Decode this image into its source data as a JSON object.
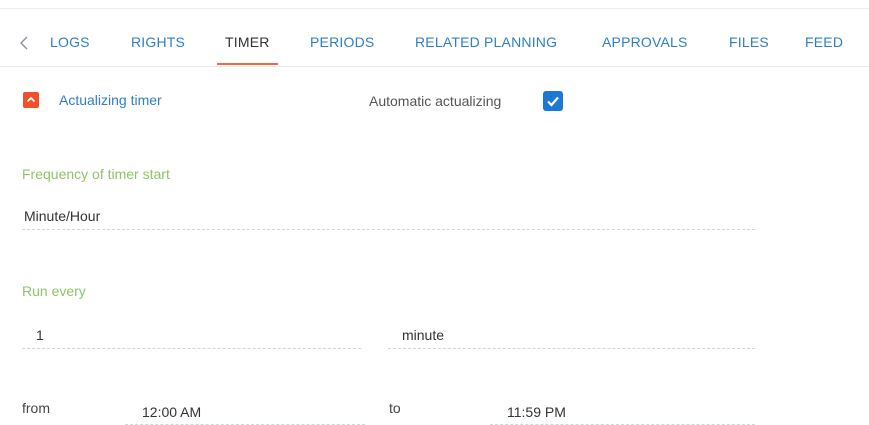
{
  "tabs": [
    {
      "label": "LOGS",
      "active": false
    },
    {
      "label": "RIGHTS",
      "active": false
    },
    {
      "label": "TIMER",
      "active": true
    },
    {
      "label": "PERIODS",
      "active": false
    },
    {
      "label": "RELATED PLANNING",
      "active": false
    },
    {
      "label": "APPROVALS",
      "active": false
    },
    {
      "label": "FILES",
      "active": false
    },
    {
      "label": "FEED",
      "active": false
    }
  ],
  "actualizing": {
    "title": "Actualizing timer",
    "automatic_label": "Automatic actualizing",
    "automatic_checked": true
  },
  "frequency": {
    "label": "Frequency of timer start",
    "value": "Minute/Hour"
  },
  "run_every": {
    "label": "Run every",
    "count": "1",
    "unit": "minute"
  },
  "time_range": {
    "from_label": "from",
    "from_value": "12:00 AM",
    "to_label": "to",
    "to_value": "11:59 PM"
  },
  "colors": {
    "accent_blue": "#2f7fc6",
    "active_tab_underline": "#f06a3d",
    "group_label_green": "#8fc46a",
    "collapse_button": "#f0512b",
    "checkbox_blue": "#1c78d4"
  }
}
